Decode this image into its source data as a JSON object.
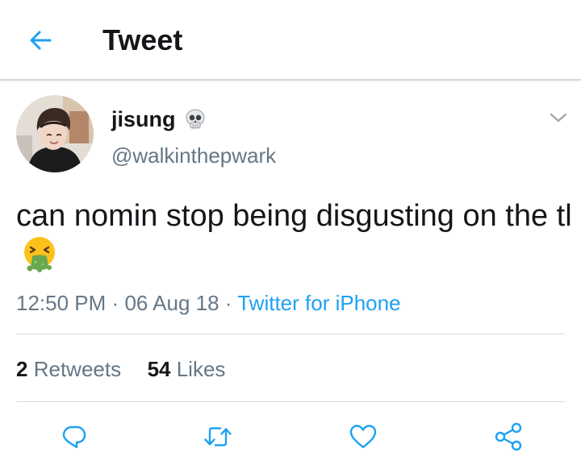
{
  "header": {
    "title": "Tweet",
    "back_icon": "back-arrow-icon",
    "accent_color": "#1da1f2"
  },
  "author": {
    "name": "jisung",
    "name_emoji": "skull-icon",
    "handle": "@walkinthepwark"
  },
  "tweet": {
    "text": "can nomin stop being disgusting on the tl",
    "emoji": "vomiting-face-icon",
    "time": "12:50 PM",
    "separator": "·",
    "date": "06 Aug 18",
    "source": "Twitter for iPhone"
  },
  "stats": {
    "retweets_count": "2",
    "retweets_label": "Retweets",
    "likes_count": "54",
    "likes_label": "Likes"
  },
  "actions": {
    "icons": [
      "reply-icon",
      "retweet-icon",
      "like-icon",
      "share-icon"
    ]
  },
  "colors": {
    "text": "#14171a",
    "secondary": "#657786",
    "link": "#1da1f2",
    "divider": "#d6dce1"
  }
}
